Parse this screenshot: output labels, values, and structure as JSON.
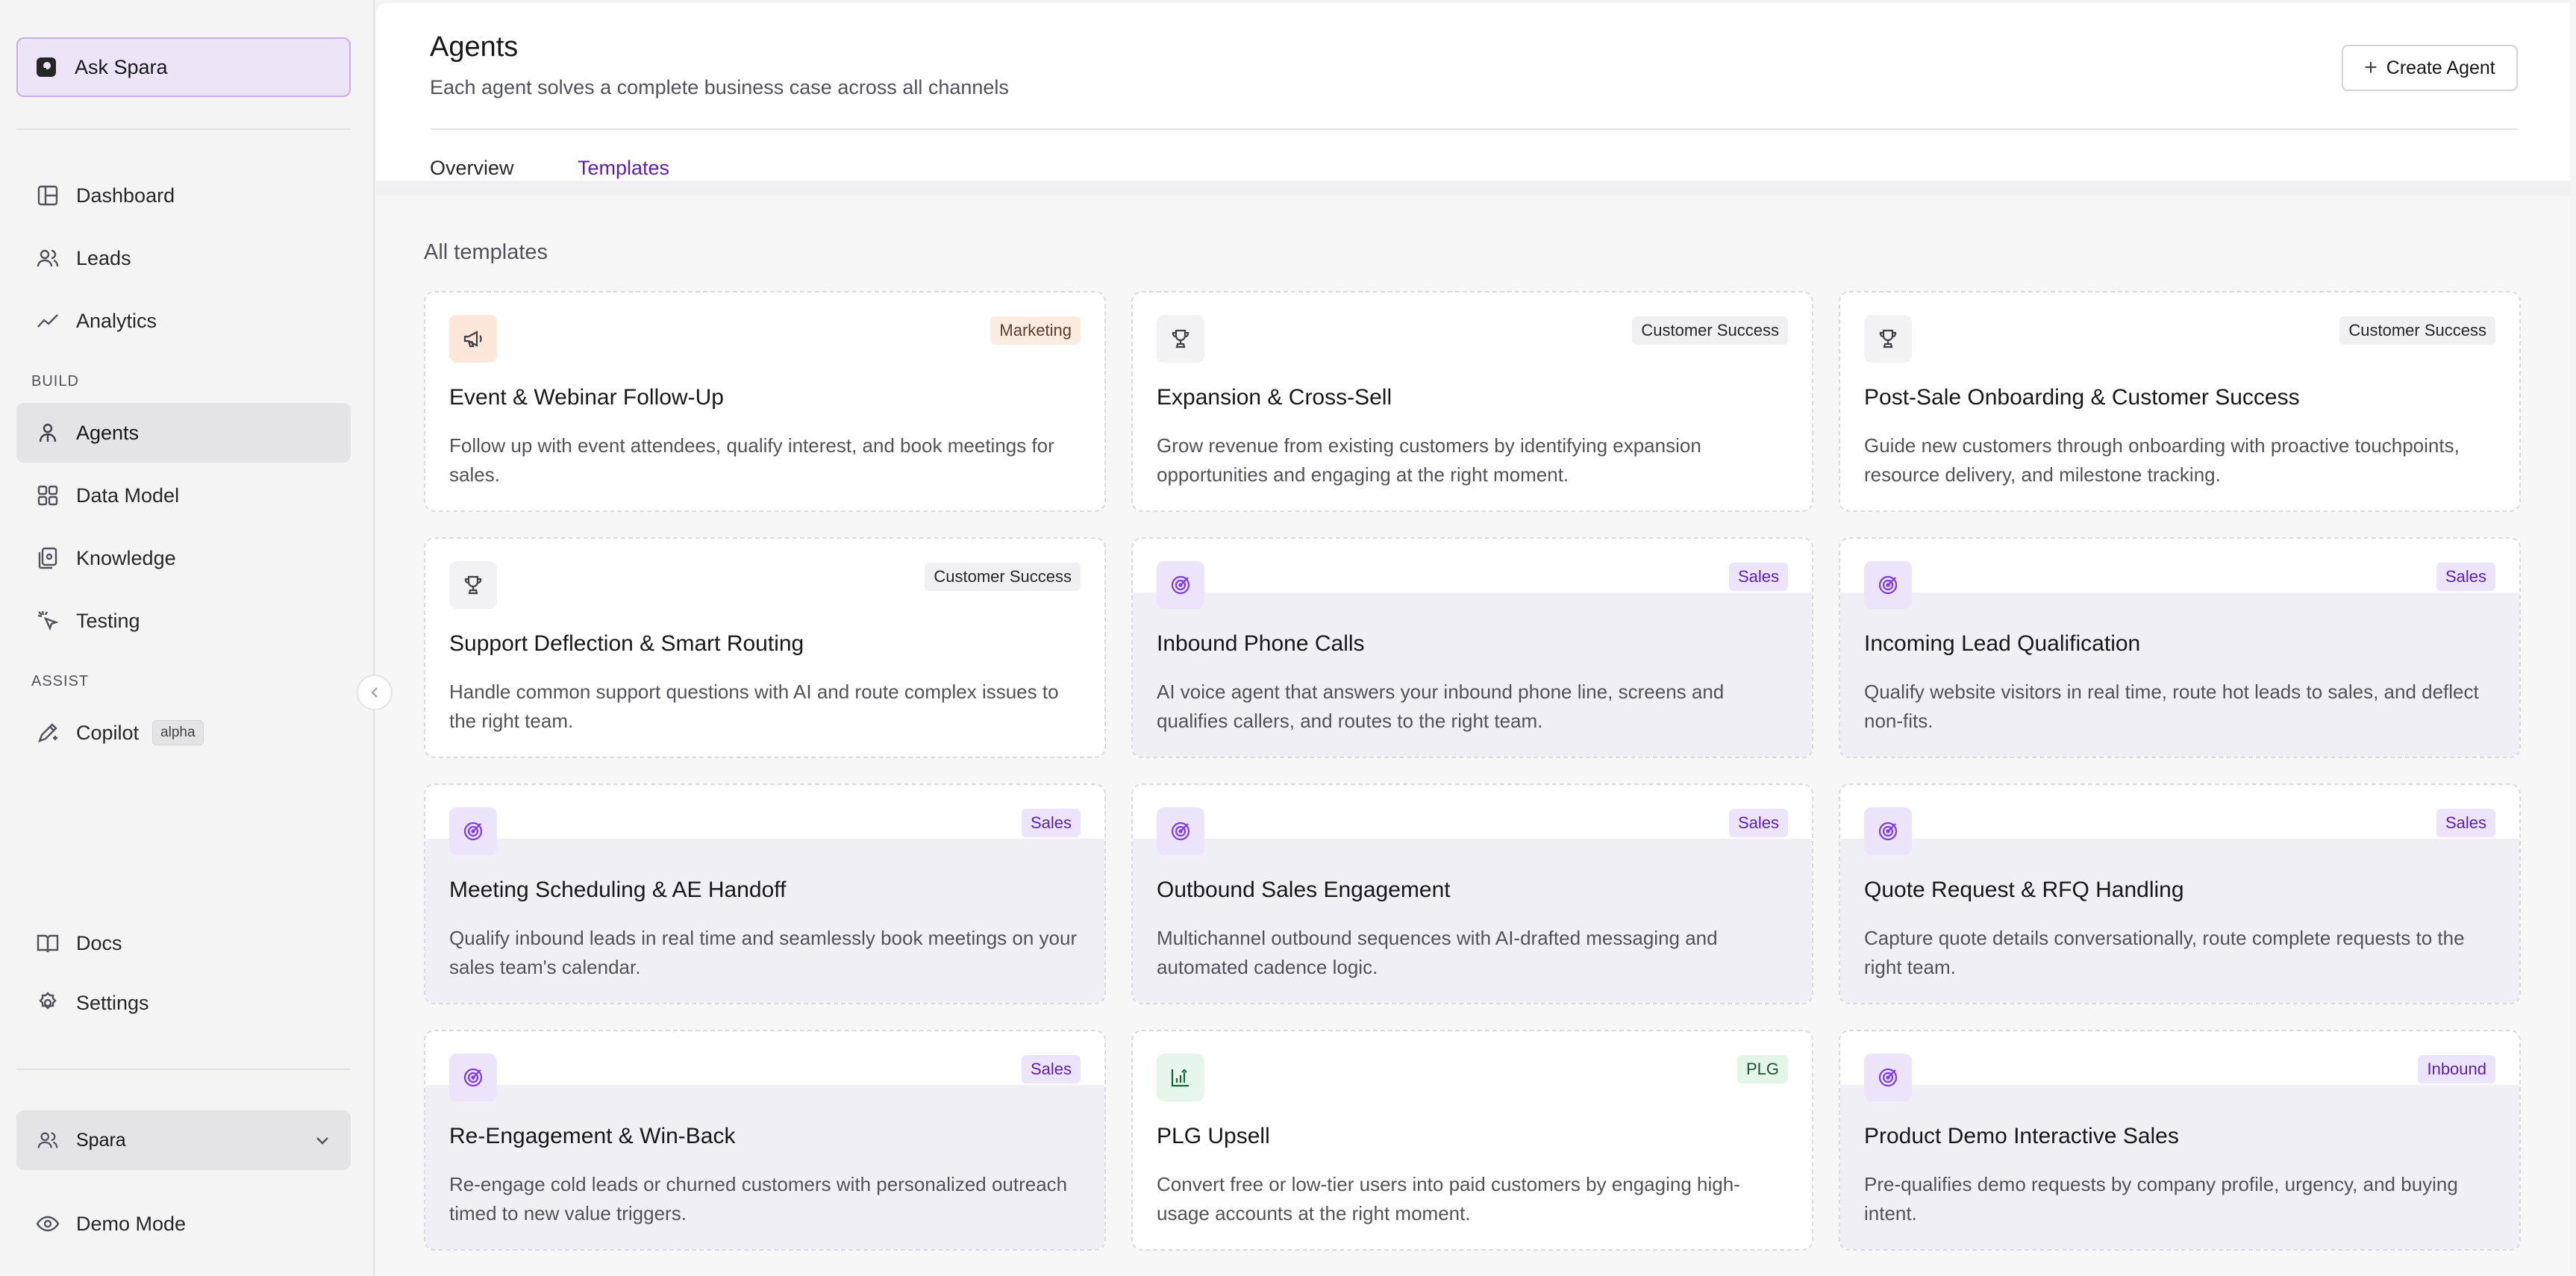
{
  "sidebar": {
    "ask_label": "Ask Spara",
    "nav_main": [
      {
        "label": "Dashboard",
        "icon": "dashboard-icon"
      },
      {
        "label": "Leads",
        "icon": "users-icon"
      },
      {
        "label": "Analytics",
        "icon": "trending-icon"
      }
    ],
    "build_label": "BUILD",
    "nav_build": [
      {
        "label": "Agents",
        "icon": "agent-icon",
        "active": true
      },
      {
        "label": "Data Model",
        "icon": "grid-icon"
      },
      {
        "label": "Knowledge",
        "icon": "documents-icon"
      },
      {
        "label": "Testing",
        "icon": "cursor-click-icon"
      }
    ],
    "assist_label": "ASSIST",
    "copilot": {
      "label": "Copilot",
      "badge": "alpha",
      "icon": "pen-sparkle-icon"
    },
    "nav_bottom": [
      {
        "label": "Docs",
        "icon": "book-icon"
      },
      {
        "label": "Settings",
        "icon": "gear-icon"
      }
    ],
    "workspace": {
      "label": "Spara",
      "icon": "users-icon"
    },
    "demo_mode": {
      "label": "Demo Mode",
      "icon": "eye-icon"
    }
  },
  "header": {
    "title": "Agents",
    "subtitle": "Each agent solves a complete business case across all channels",
    "create_button": "Create Agent",
    "tabs": [
      {
        "label": "Overview",
        "active": false
      },
      {
        "label": "Templates",
        "active": true
      }
    ]
  },
  "templates": {
    "section_title": "All templates",
    "cards": [
      {
        "title": "Event & Webinar Follow-Up",
        "badge": "Marketing",
        "category": "marketing",
        "icon": "megaphone-icon",
        "description": "Follow up with event attendees, qualify interest, and book meetings for sales."
      },
      {
        "title": "Expansion & Cross-Sell",
        "badge": "Customer Success",
        "category": "cs",
        "icon": "trophy-icon",
        "description": "Grow revenue from existing customers by identifying expansion opportunities and engaging at the right moment."
      },
      {
        "title": "Post-Sale Onboarding & Customer Success",
        "badge": "Customer Success",
        "category": "cs",
        "icon": "trophy-icon",
        "description": "Guide new customers through onboarding with proactive touchpoints, resource delivery, and milestone tracking."
      },
      {
        "title": "Support Deflection & Smart Routing",
        "badge": "Customer Success",
        "category": "cs",
        "icon": "trophy-icon",
        "description": "Handle common support questions with AI and route complex issues to the right team."
      },
      {
        "title": "Inbound Phone Calls",
        "badge": "Sales",
        "category": "sales",
        "icon": "target-icon",
        "description": "AI voice agent that answers your inbound phone line, screens and qualifies callers, and routes to the right team."
      },
      {
        "title": "Incoming Lead Qualification",
        "badge": "Sales",
        "category": "sales",
        "icon": "target-icon",
        "description": "Qualify website visitors in real time, route hot leads to sales, and deflect non-fits."
      },
      {
        "title": "Meeting Scheduling & AE Handoff",
        "badge": "Sales",
        "category": "sales",
        "icon": "target-icon",
        "description": "Qualify inbound leads in real time and seamlessly book meetings on your sales team's calendar."
      },
      {
        "title": "Outbound Sales Engagement",
        "badge": "Sales",
        "category": "sales",
        "icon": "target-icon",
        "description": "Multichannel outbound sequences with AI-drafted messaging and automated cadence logic."
      },
      {
        "title": "Quote Request & RFQ Handling",
        "badge": "Sales",
        "category": "sales",
        "icon": "target-icon",
        "description": "Capture quote details conversationally, route complete requests to the right team."
      },
      {
        "title": "Re-Engagement & Win-Back",
        "badge": "Sales",
        "category": "sales",
        "icon": "target-icon",
        "description": "Re-engage cold leads or churned customers with personalized outreach timed to new value triggers."
      },
      {
        "title": "PLG Upsell",
        "badge": "PLG",
        "category": "plg",
        "icon": "chart-up-icon",
        "description": "Convert free or low-tier users into paid customers by engaging high-usage accounts at the right moment."
      },
      {
        "title": "Product Demo Interactive Sales",
        "badge": "Inbound",
        "category": "inbound",
        "icon": "target-icon",
        "description": "Pre-qualifies demo requests by company profile, urgency, and buying intent."
      }
    ]
  }
}
